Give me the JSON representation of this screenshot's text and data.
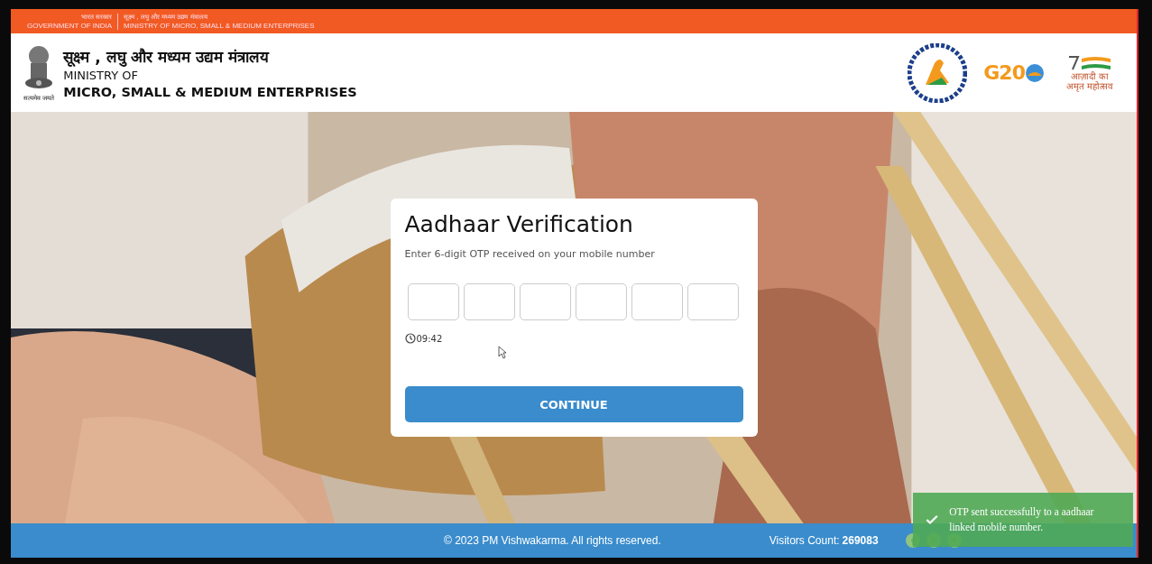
{
  "top_bar": {
    "left": {
      "hindi": "भारत सरकार",
      "english": "GOVERNMENT OF INDIA"
    },
    "right": {
      "hindi": "सूक्ष्म , लघु और मध्यम उद्यम मंत्रालय",
      "english": "MINISTRY OF MICRO, SMALL & MEDIUM ENTERPRISES"
    }
  },
  "header": {
    "emblem_motto": "सत्यमेव जयते",
    "title_hindi": "सूक्ष्म , लघु और मध्यम उद्यम मंत्रालय",
    "title_line1": "MINISTRY OF",
    "title_line2": "MICRO, SMALL & MEDIUM ENTERPRISES",
    "logos": [
      {
        "kind": "vishwakarma"
      },
      {
        "kind": "g20",
        "text": "G20"
      },
      {
        "kind": "azadi",
        "text": "आज़ादी का अमृत महोत्सव"
      }
    ]
  },
  "card": {
    "title": "Aadhaar Verification",
    "subtitle": "Enter 6-digit OTP received on your mobile number",
    "otp_boxes": [
      {
        "focused": false
      },
      {
        "focused": false
      },
      {
        "focused": false
      },
      {
        "focused": false
      },
      {
        "focused": false
      },
      {
        "focused": false
      }
    ],
    "timer": "09:42",
    "button": "CONTINUE"
  },
  "footer": {
    "copyright": "© 2023 PM Vishwakarma. All rights reserved.",
    "visitors_label": "Visitors Count:",
    "visitors_value": "269083"
  },
  "toast": {
    "message": "OTP sent successfully to a aadhaar linked mobile number."
  }
}
